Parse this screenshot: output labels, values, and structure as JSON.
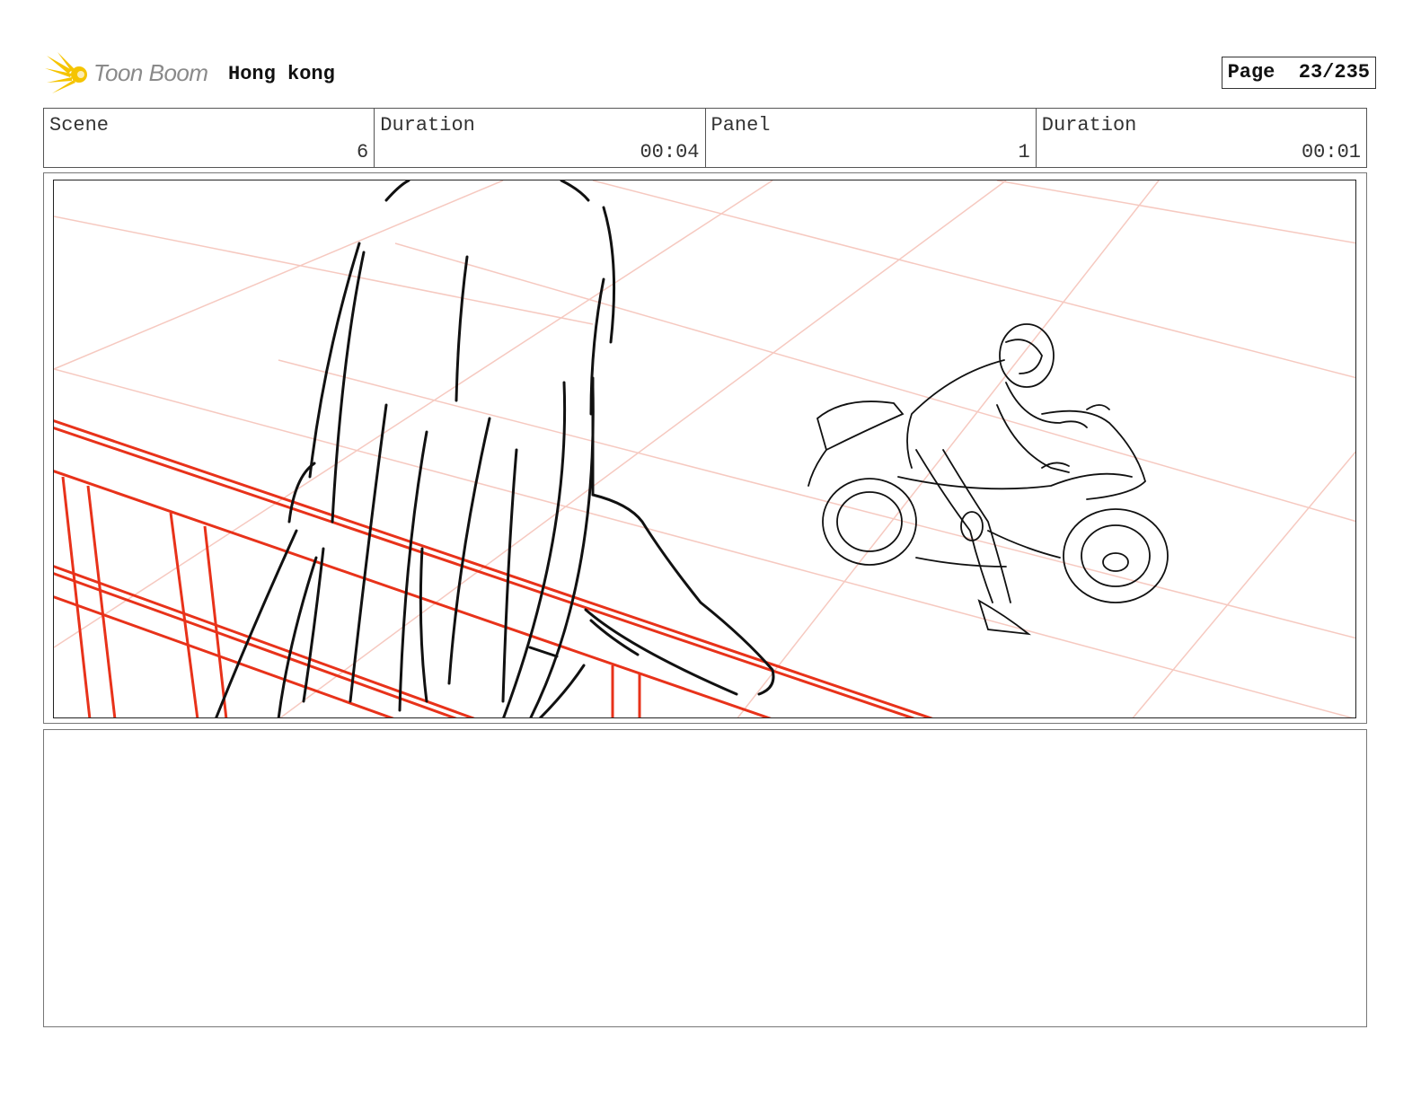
{
  "header": {
    "logo_text": "Toon Boom",
    "project_title": "Hong kong",
    "page_label": "Page",
    "page_number": "23/235"
  },
  "info": {
    "scene_label": "Scene",
    "scene_value": "6",
    "scene_duration_label": "Duration",
    "scene_duration_value": "00:04",
    "panel_label": "Panel",
    "panel_value": "1",
    "panel_duration_label": "Duration",
    "panel_duration_value": "00:01"
  },
  "colors": {
    "logo_yellow": "#f5c400",
    "railing_red": "#e8321a",
    "grid_pink": "#f6c9c0",
    "sketch_black": "#111111"
  },
  "notes": {
    "text": ""
  }
}
